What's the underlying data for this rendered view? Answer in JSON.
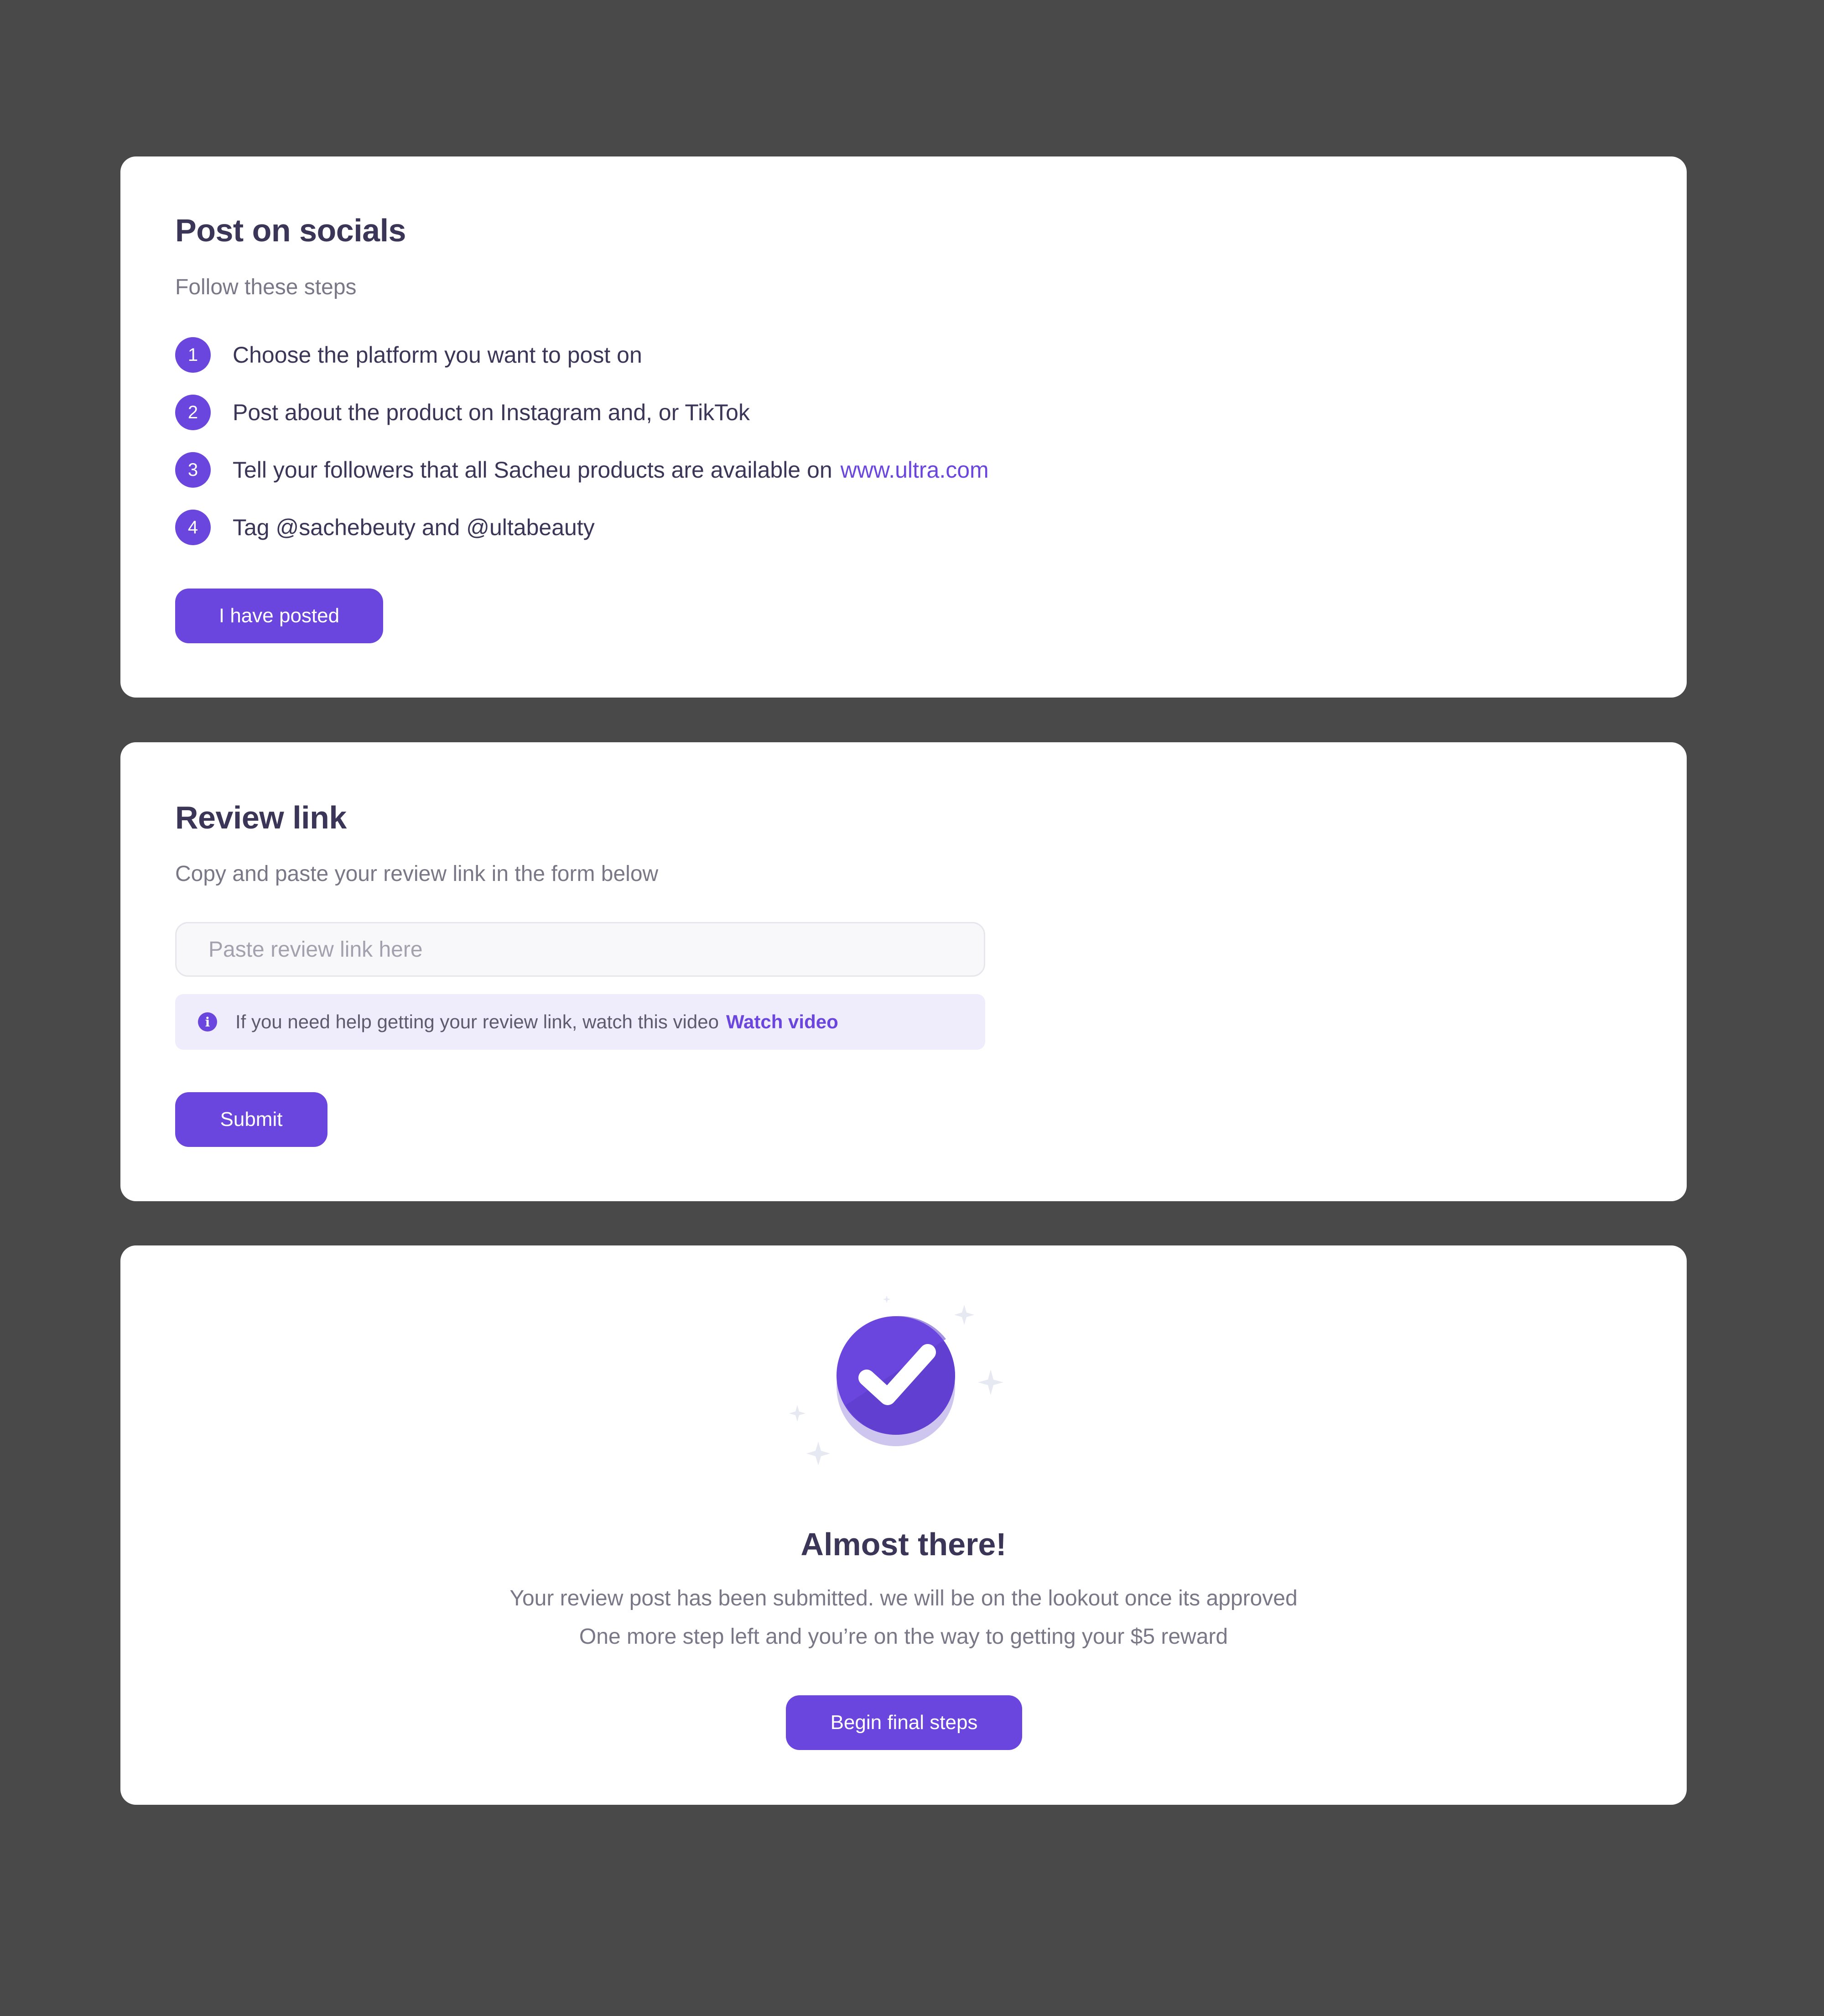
{
  "socials": {
    "title": "Post on socials",
    "subtitle": "Follow these steps",
    "steps": [
      {
        "num": "1",
        "text": "Choose the platform you want to post on"
      },
      {
        "num": "2",
        "text": "Post about the product on Instagram and, or TikTok"
      },
      {
        "num": "3",
        "text": "Tell your followers that all Sacheu products are available on",
        "link": "www.ultra.com"
      },
      {
        "num": "4",
        "text": "Tag @sachebeuty and @ultabeauty"
      }
    ],
    "button_label": "I have posted"
  },
  "review": {
    "title": "Review link",
    "subtitle": "Copy and paste your review link in the form below",
    "input_placeholder": "Paste review link here",
    "input_value": "",
    "help_text": "If you need help getting your review link, watch this video",
    "help_link": "Watch video",
    "submit_label": "Submit"
  },
  "done": {
    "icon": "check-circle-icon",
    "title": "Almost there!",
    "line1": "Your review post has been submitted. we will be on the lookout once its approved",
    "line2": "One more step left and you’re on the way to getting your $5 reward",
    "button_label": "Begin final steps"
  },
  "colors": {
    "background": "#494949",
    "card": "#ffffff",
    "accent": "#6a45de",
    "heading": "#3b3557",
    "muted": "#7a7786",
    "help_bg": "#efedfb"
  }
}
